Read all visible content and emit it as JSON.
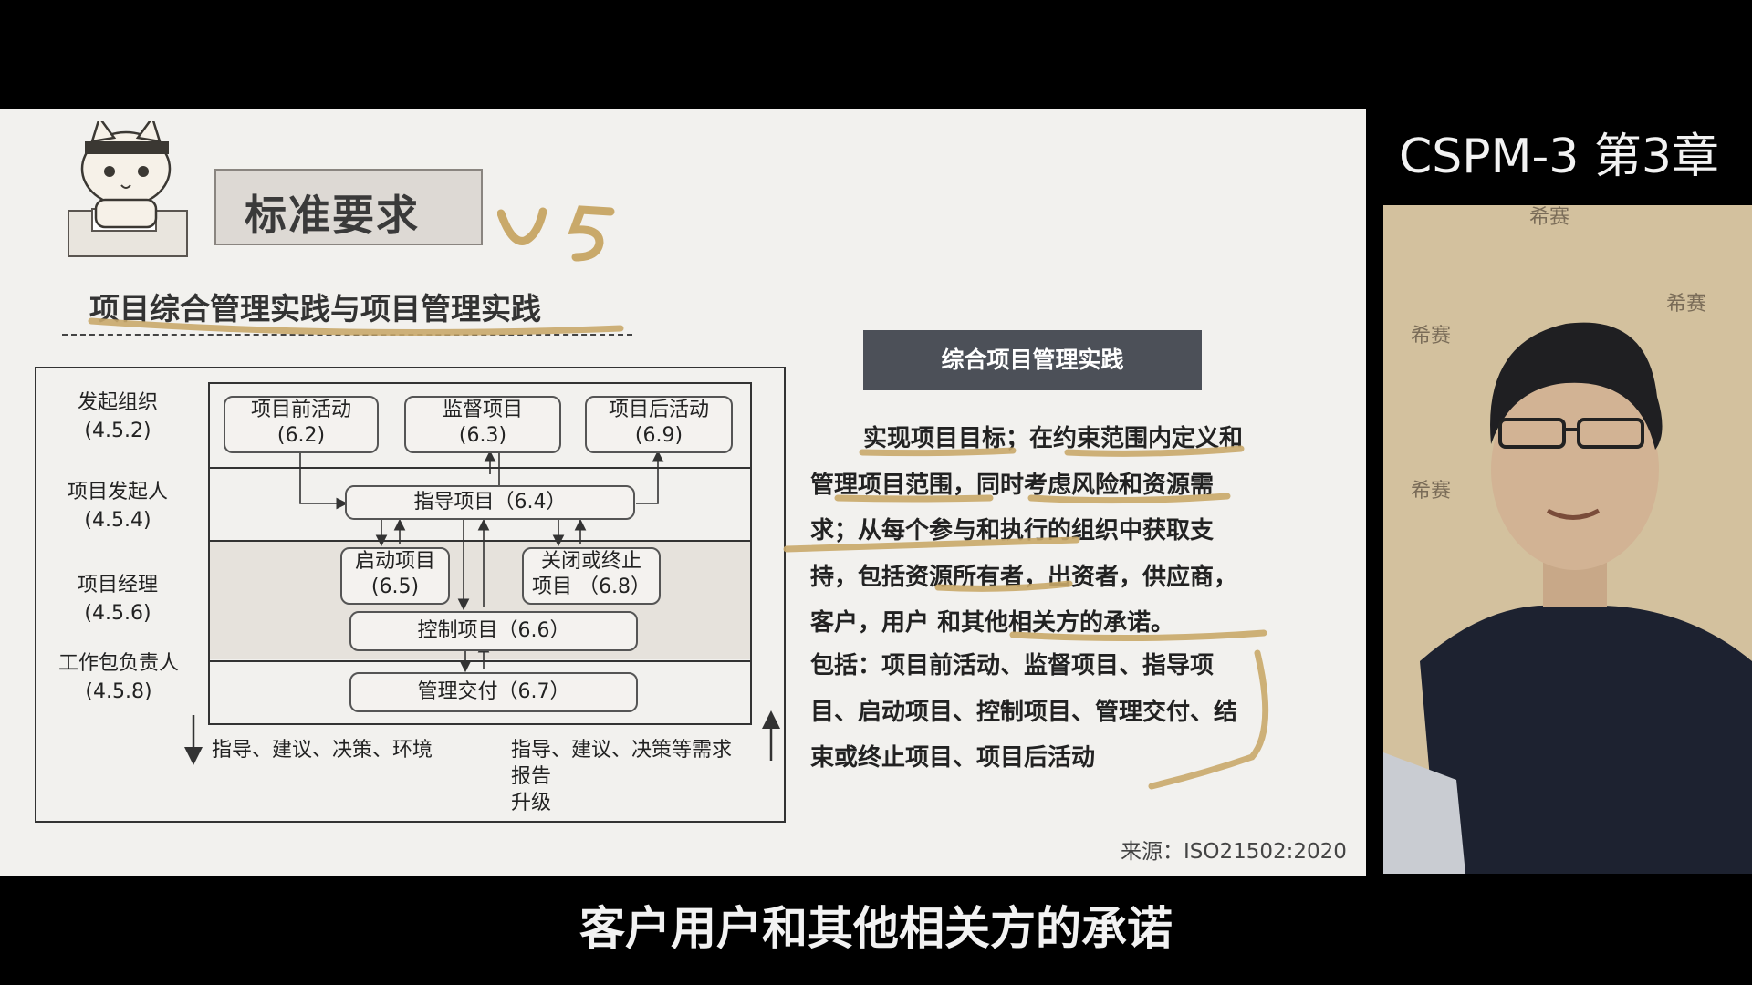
{
  "slide": {
    "header_title": "标准要求",
    "header_handwriting": "VS",
    "sub_title": "项目综合管理实践与项目管理实践",
    "roles": [
      {
        "name": "发起组织",
        "code": "(4.5.2)"
      },
      {
        "name": "项目发起人",
        "code": "(4.5.4)"
      },
      {
        "name": "项目经理",
        "code": "(4.5.6)"
      },
      {
        "name": "工作包负责人",
        "code": "(4.5.8)"
      }
    ],
    "nodes": {
      "pre": {
        "title": "项目前活动",
        "code": "(6.2)"
      },
      "oversee": {
        "title": "监督项目",
        "code": "(6.3)"
      },
      "post": {
        "title": "项目后活动",
        "code": "(6.9)"
      },
      "direct": {
        "title": "指导项目（6.4）"
      },
      "start": {
        "title": "启动项目",
        "code": "(6.5)"
      },
      "close": {
        "title": "关闭或终止",
        "code": "项目 （6.8）"
      },
      "control": {
        "title": "控制项目（6.6）"
      },
      "deliver": {
        "title": "管理交付（6.7）"
      }
    },
    "bottom_left_note": "指导、建议、决策、环境",
    "bottom_right_note": [
      "指导、建议、决策等需求",
      "报告",
      "升级"
    ],
    "panel_title": "综合项目管理实践",
    "paragraph_1": "实现项目目标；在约束范围内定义和管理项目范围，同时考虑风险和资源需求；从每个参与和执行的组织中获取支持，包括资源所有者，出资者，供应商，客户，用户 和其他相关方的承诺。",
    "paragraph_2": "包括：项目前活动、监督项目、指导项目、启动项目、控制项目、管理交付、结束或终止项目、项目后活动",
    "source": "来源：ISO21502:2020"
  },
  "video": {
    "course_title": "CSPM-3 第3章",
    "watermark": "希赛"
  },
  "subtitle": "客户用户和其他相关方的承诺",
  "colors": {
    "highlight": "#c9a96a",
    "panel_head": "#4c5058",
    "slide_bg": "#f2f1ee"
  }
}
